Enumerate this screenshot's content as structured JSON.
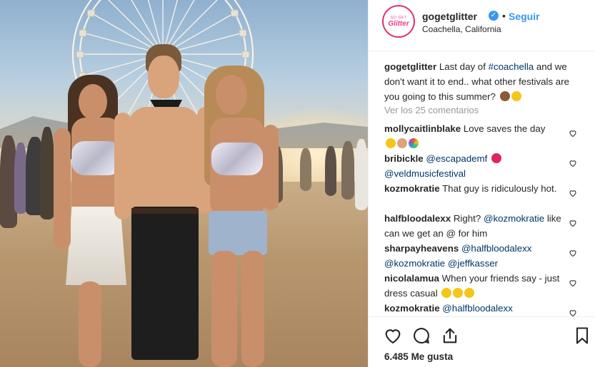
{
  "post": {
    "account": {
      "username": "gogetglitter",
      "verified_icon": "verified-badge-icon",
      "avatar_text_top": "GO GET",
      "avatar_text_bottom": "Glitter",
      "follow_label": "Seguir",
      "separator": "•",
      "location": "Coachella, California"
    },
    "caption": {
      "username": "gogetglitter",
      "text_before": "Last day of ",
      "hashtag": "#coachella",
      "text_after": " and we don't want it to end.. what other festivals are you going to this summer?"
    },
    "view_all_comments": "Ver los 25 comentarios",
    "comments": [
      {
        "username": "mollycaitlinblake",
        "text": "Love saves the day"
      },
      {
        "username": "bribickle",
        "mention1": "@escapademf",
        "mention2": "@veldmusicfestival"
      },
      {
        "username": "kozmokratie",
        "text": "That guy is ridiculously hot."
      },
      {
        "username": "halfbloodalexx",
        "text_before": "Right? ",
        "mention": "@kozmokratie",
        "text_after": " like can we get an @ for him"
      },
      {
        "username": "sharpayheavens",
        "mention1": "@halfbloodalexx",
        "mention2": "@kozmokratie",
        "mention3": "@jeffkasser"
      },
      {
        "username": "nicolalamua",
        "text": "When your friends say - just dress casual"
      },
      {
        "username": "kozmokratie",
        "mention": "@halfbloodalexx"
      }
    ],
    "likes_count": "6.485",
    "likes_label": "Me gusta",
    "icons": {
      "like": "heart-icon",
      "comment": "comment-icon",
      "share": "share-icon",
      "save": "bookmark-icon"
    },
    "colors": {
      "link_blue": "#3897f0",
      "hashtag": "#003569",
      "muted": "#999999"
    }
  }
}
